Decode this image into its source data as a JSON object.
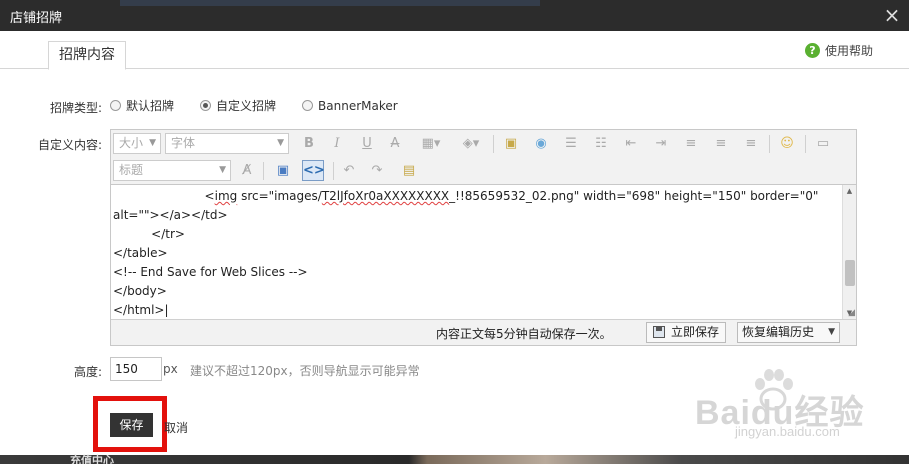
{
  "window": {
    "title": "店铺招牌",
    "close": "×"
  },
  "tabs": [
    {
      "label": "招牌内容"
    }
  ],
  "help": {
    "icon_text": "?",
    "label": "使用帮助"
  },
  "signboard": {
    "type_label": "招牌类型:",
    "options": [
      {
        "label": "默认招牌",
        "selected": false
      },
      {
        "label": "自定义招牌",
        "selected": true
      },
      {
        "label": "BannerMaker",
        "selected": false
      }
    ]
  },
  "editor": {
    "label": "自定义内容:",
    "toolbar": {
      "font_size": "大小",
      "font_family": "字体",
      "heading": "标题",
      "bold": "B",
      "italic": "I",
      "underline": "U",
      "strike": "A"
    },
    "lines": [
      {
        "pre": "                        <",
        "sq": "img",
        "mid": " src=\"images/",
        "sq2": "T2lJfoXr0aXXXXXXXX",
        "post": "_!!85659532_02.png\" width=\"698\" height=\"150\" border=\"0\""
      },
      {
        "pre": "alt=\"\"></a></td>",
        "sq": "",
        "mid": "",
        "sq2": "",
        "post": ""
      },
      {
        "pre": "          </tr>",
        "sq": "",
        "mid": "",
        "sq2": "",
        "post": ""
      },
      {
        "pre": "</table>",
        "sq": "",
        "mid": "",
        "sq2": "",
        "post": ""
      },
      {
        "pre": "<!-- End Save for Web Slices -->",
        "sq": "",
        "mid": "",
        "sq2": "",
        "post": ""
      },
      {
        "pre": "</body>",
        "sq": "",
        "mid": "",
        "sq2": "",
        "post": ""
      },
      {
        "pre": "</html>|",
        "sq": "",
        "mid": "",
        "sq2": "",
        "post": ""
      }
    ],
    "autosave_msg": "内容正文每5分钟自动保存一次。",
    "save_now": "立即保存",
    "restore_history": "恢复编辑历史"
  },
  "height": {
    "label": "高度:",
    "value": "150",
    "unit": "px",
    "hint": "建议不超过120px，否则导航显示可能异常"
  },
  "actions": {
    "save": "保存",
    "cancel": "取消"
  },
  "background": {
    "bottom_text": "充值中心"
  },
  "watermark": {
    "brand": "Baidu经验",
    "url": "jingyan.baidu.com"
  }
}
